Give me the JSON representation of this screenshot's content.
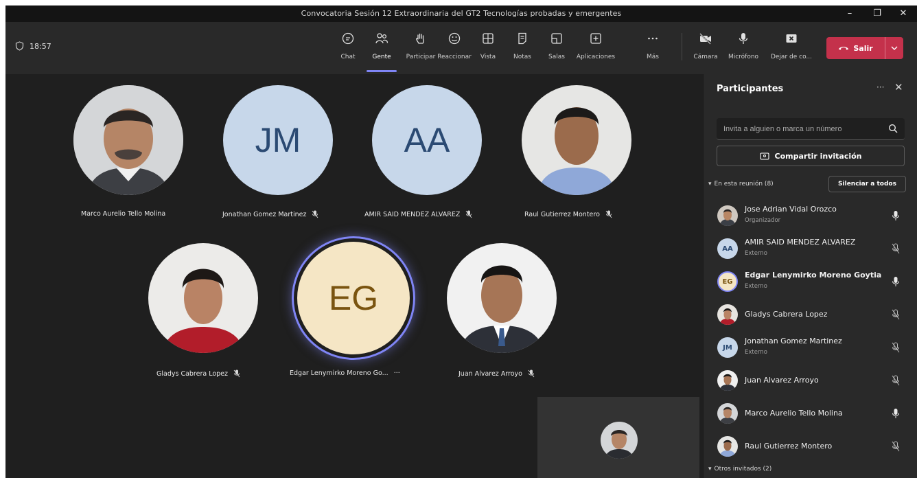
{
  "window": {
    "title": "Convocatoria Sesión 12 Extraordinaria del GT2 Tecnologías probadas y emergentes",
    "minimize_glyph": "–",
    "maximize_glyph": "❐",
    "close_glyph": "✕"
  },
  "toolbar": {
    "timer": "18:57",
    "buttons": [
      {
        "id": "chat",
        "label": "Chat",
        "icon": "chat-icon"
      },
      {
        "id": "people",
        "label": "Gente",
        "icon": "people-icon",
        "active": true
      },
      {
        "id": "raise",
        "label": "Participar",
        "icon": "raise-hand-icon"
      },
      {
        "id": "react",
        "label": "Reaccionar",
        "icon": "smiley-icon"
      },
      {
        "id": "view",
        "label": "Vista",
        "icon": "grid-view-icon"
      },
      {
        "id": "notes",
        "label": "Notas",
        "icon": "notes-icon"
      },
      {
        "id": "rooms",
        "label": "Salas",
        "icon": "rooms-icon"
      },
      {
        "id": "apps",
        "label": "Aplicaciones",
        "icon": "add-app-icon"
      },
      {
        "id": "more",
        "label": "Más",
        "icon": "more-icon"
      },
      {
        "id": "camera",
        "label": "Cámara",
        "icon": "camera-off-icon"
      },
      {
        "id": "mic",
        "label": "Micrófono",
        "icon": "microphone-icon"
      },
      {
        "id": "share",
        "label": "Dejar de co...",
        "icon": "stop-share-icon"
      }
    ],
    "leave_label": "Salir"
  },
  "stage": {
    "tiles": [
      {
        "name": "Marco Aurelio Tello Molina",
        "type": "photo",
        "muted": false
      },
      {
        "name": "Jonathan Gomez Martinez",
        "type": "initials",
        "initials": "JM",
        "muted": true
      },
      {
        "name": "AMIR SAID MENDEZ ALVAREZ",
        "type": "initials",
        "initials": "AA",
        "muted": true
      },
      {
        "name": "Raul Gutierrez Montero",
        "type": "photo",
        "muted": true
      },
      {
        "name": "Gladys Cabrera Lopez",
        "type": "photo",
        "muted": true
      },
      {
        "name": "Edgar Lenymirko Moreno Go...",
        "type": "initials",
        "initials": "EG",
        "speaking": true,
        "more": "···"
      },
      {
        "name": "Juan Alvarez Arroyo",
        "type": "photo",
        "muted": true
      }
    ]
  },
  "panel": {
    "title": "Participantes",
    "more_glyph": "···",
    "close_glyph": "✕",
    "search_placeholder": "Invita a alguien o marca un número",
    "share_label": "Compartir invitación",
    "in_meeting_label": "En esta reunión (8)",
    "mute_all_label": "Silenciar a todos",
    "others_label": "Otros invitados (2)",
    "participants": [
      {
        "name": "Jose Adrian Vidal Orozco",
        "role": "Organizador",
        "avatar": "photo",
        "mic": "on"
      },
      {
        "name": "AMIR SAID MENDEZ ALVAREZ",
        "role": "Externo",
        "avatar": "initials",
        "initials": "AA",
        "mic": "off"
      },
      {
        "name": "Edgar Lenymirko Moreno Goytia",
        "role": "Externo",
        "avatar": "initials",
        "initials": "EG",
        "mic": "on",
        "bold": true
      },
      {
        "name": "Gladys Cabrera Lopez",
        "role": "",
        "avatar": "photo",
        "mic": "off"
      },
      {
        "name": "Jonathan Gomez Martinez",
        "role": "Externo",
        "avatar": "initials",
        "initials": "JM",
        "mic": "off"
      },
      {
        "name": "Juan Alvarez Arroyo",
        "role": "",
        "avatar": "photo",
        "mic": "off"
      },
      {
        "name": "Marco Aurelio Tello Molina",
        "role": "",
        "avatar": "photo",
        "mic": "on"
      },
      {
        "name": "Raul Gutierrez Montero",
        "role": "",
        "avatar": "photo",
        "mic": "off"
      }
    ]
  },
  "colors": {
    "accent": "#7f85f5",
    "leave": "#c4314b",
    "initials_blue_bg": "#c7d7ea",
    "initials_blue_text": "#2b4a73",
    "initials_gold_bg": "#f5e6c5",
    "initials_gold_text": "#7a5410"
  }
}
